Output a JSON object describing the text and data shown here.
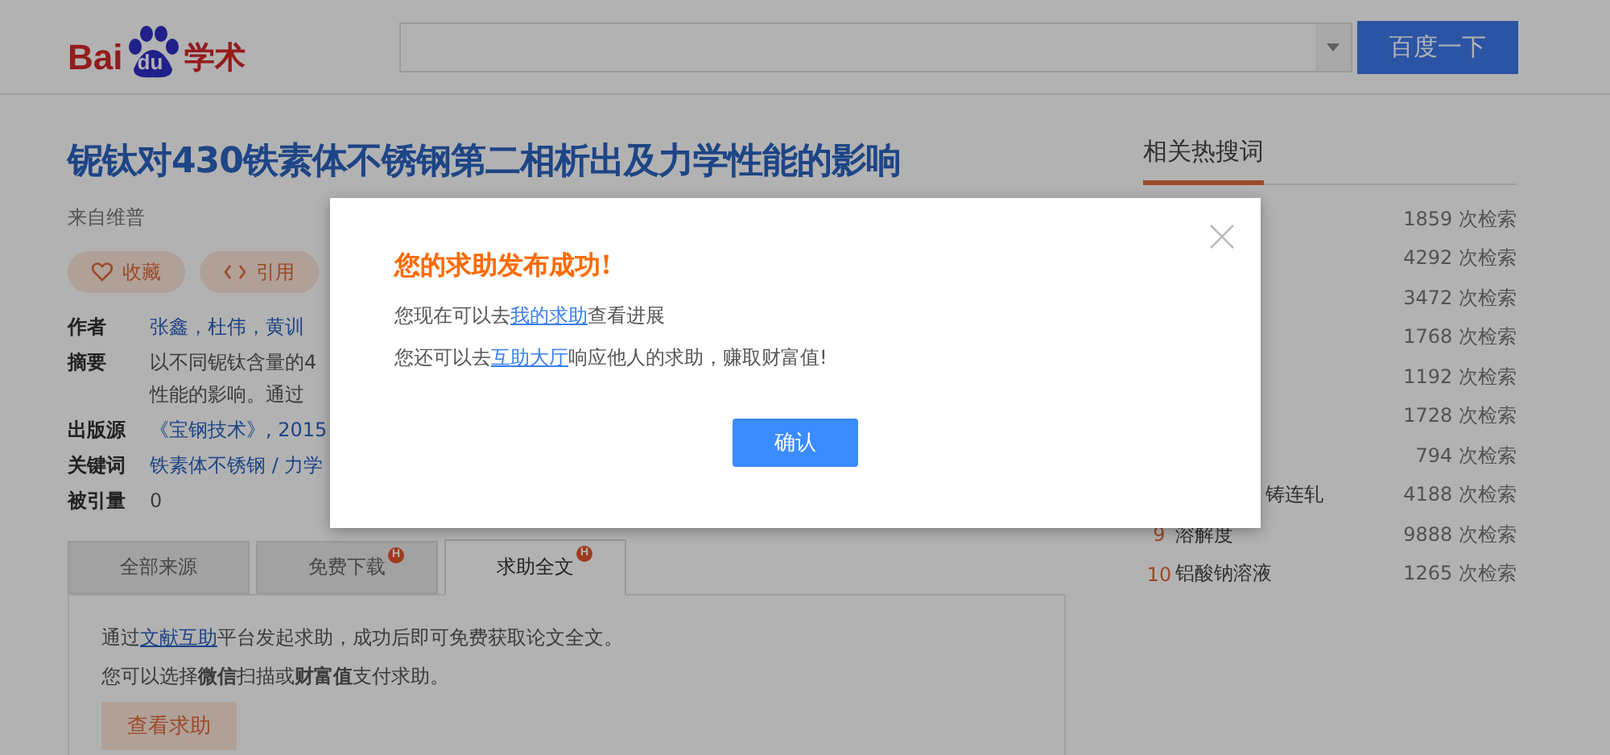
{
  "header": {
    "logo": {
      "left": "Bai",
      "mark": "du",
      "right": "学术"
    },
    "search_button": "百度一下"
  },
  "paper": {
    "title": "铌钛对430铁素体不锈钢第二相析出及力学性能的影响",
    "source_note": "来自维普",
    "actions": [
      {
        "kind": "favorite",
        "label": "收藏"
      },
      {
        "kind": "cite",
        "label": "引用"
      }
    ],
    "details": [
      {
        "label": "作者",
        "kind": "link",
        "lines": [
          "张鑫，杜伟，黄训"
        ]
      },
      {
        "label": "摘要",
        "kind": "text",
        "lines": [
          "以不同铌钛含量的4",
          "性能的影响。通过"
        ]
      },
      {
        "label": "出版源",
        "kind": "link",
        "lines": [
          "《宝钢技术》, 2015"
        ]
      },
      {
        "label": "关键词",
        "kind": "link",
        "lines": [
          "铁素体不锈钢 / 力学"
        ]
      },
      {
        "label": "被引量",
        "kind": "text",
        "lines": [
          "0"
        ]
      }
    ],
    "tabs": [
      {
        "label": "全部来源",
        "selected": false
      },
      {
        "label": "免费下载",
        "badge": "H",
        "selected": false
      },
      {
        "label": "求助全文",
        "badge": "H",
        "selected": true
      }
    ],
    "panel": {
      "lines": [
        {
          "before": "通过",
          "link": "文献互助",
          "after": "平台发起求助，成功后即可免费获取论文全文。"
        },
        {
          "text": "您可以选择**微信**扫描或**财富值**支付求助。"
        }
      ],
      "button": "查看求助"
    }
  },
  "hot_words": {
    "title": "相关热搜词",
    "items": [
      {
        "count": "1859 次检索"
      },
      {
        "count": "4292 次检索"
      },
      {
        "count": "3472 次检索"
      },
      {
        "count": "1768 次检索"
      },
      {
        "count": "1192 次检索"
      },
      {
        "count": "1728 次检索"
      },
      {
        "count": "794 次检索"
      },
      {
        "word": "铸连轧",
        "count": "4188 次检索"
      },
      {
        "rank": "9",
        "word": "溶解度",
        "count": "9888 次检索"
      },
      {
        "rank": "10",
        "word": "铝酸钠溶液",
        "count": "1265 次检索"
      }
    ]
  },
  "dialog": {
    "title": "您的求助发布成功!",
    "lines": [
      [
        "您现在可以去",
        "我的求助",
        "查看进展"
      ],
      [
        "您还可以去",
        "互助大厅",
        "响应他人的求助，赚取财富值!"
      ]
    ],
    "button": "确认"
  }
}
